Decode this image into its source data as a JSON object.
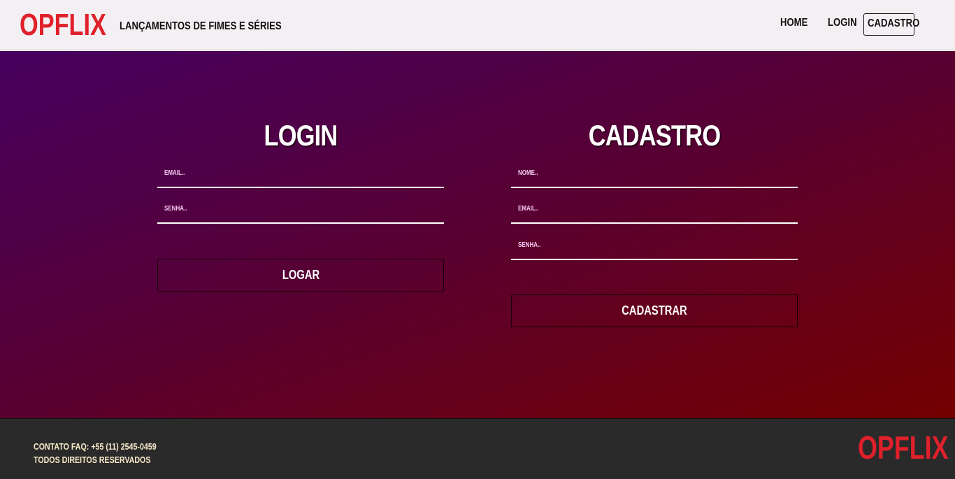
{
  "header": {
    "logo": "OPFLIX",
    "tagline": "LANÇAMENTOS DE FIMES E SÉRIES",
    "nav": {
      "home": "HOME",
      "login": "LOGIN",
      "cadastro": "CADASTRO"
    }
  },
  "login": {
    "title": "LOGIN",
    "email_placeholder": "EMAIL..",
    "senha_placeholder": "SENHA..",
    "button": "LOGAR"
  },
  "cadastro": {
    "title": "CADASTRO",
    "nome_placeholder": "NOME..",
    "email_placeholder": "EMAIL..",
    "senha_placeholder": "SENHA..",
    "button": "CADASTRAR"
  },
  "footer": {
    "contato": "CONTATO FAQ: +55 (11) 2545-0459",
    "direitos": "TODOS DIREITOS RESERVADOS",
    "logo": "OPFLIX"
  },
  "colors": {
    "brand": "#e0202a",
    "header_bg": "#f3eff3",
    "footer_bg": "#2a2a2a",
    "gradient_start": "#46005f",
    "gradient_end": "#730000"
  }
}
